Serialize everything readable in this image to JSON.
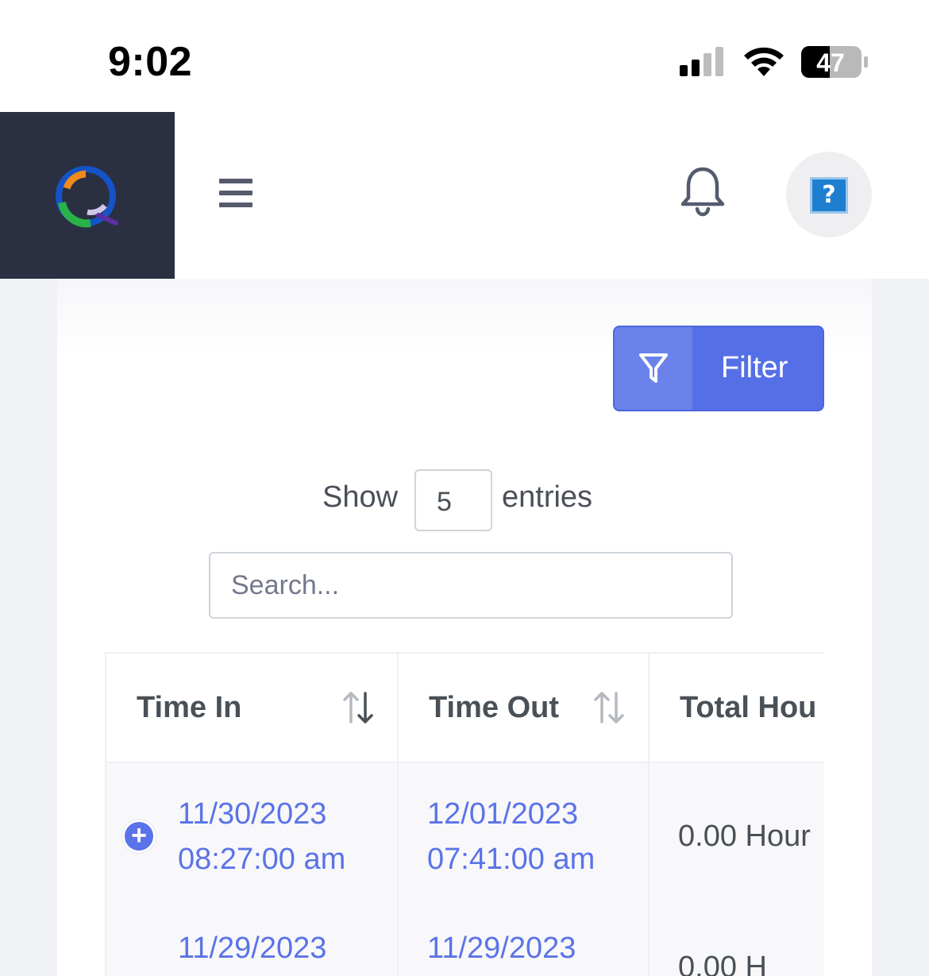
{
  "status_bar": {
    "time": "9:02",
    "battery": "47"
  },
  "header": {
    "logo": "app-logo",
    "avatar_placeholder": "?"
  },
  "toolbar": {
    "filter_label": "Filter"
  },
  "entries": {
    "show_label": "Show",
    "value": "5",
    "entries_label": "entries"
  },
  "search": {
    "placeholder": "Search...",
    "value": ""
  },
  "table": {
    "columns": [
      "Time In",
      "Time Out",
      "Total Hou"
    ],
    "rows": [
      {
        "time_in_date": "11/30/2023",
        "time_in_time": "08:27:00 am",
        "time_out_date": "12/01/2023",
        "time_out_time": "07:41:00 am",
        "total": "0.00 Hour"
      },
      {
        "time_in_date": "11/29/2023",
        "time_in_time": "",
        "time_out_date": "11/29/2023",
        "time_out_time": "",
        "total": "0.00 H"
      }
    ]
  },
  "colors": {
    "accent": "#5b73e8",
    "sidebar_dark": "#2a3042",
    "filter_button": "#5570e6"
  }
}
